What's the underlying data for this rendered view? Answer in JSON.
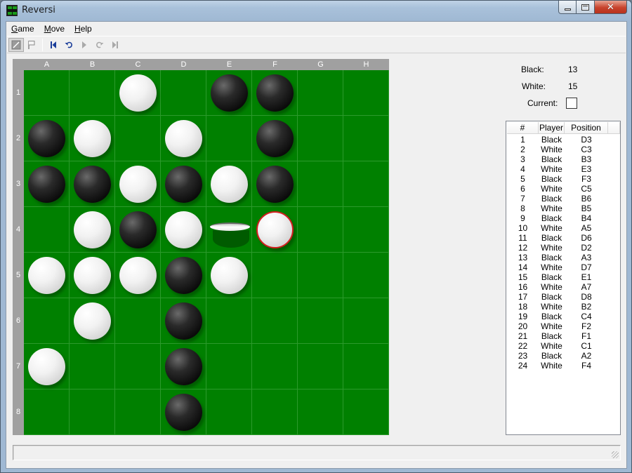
{
  "window": {
    "title": "Reversi",
    "colors": {
      "board": "#008000",
      "frame": "#a0a0a0",
      "last_move_ring": "#d21e1e"
    }
  },
  "menu": {
    "game": {
      "accel": "G",
      "rest": "ame"
    },
    "move": {
      "accel": "M",
      "rest": "ove"
    },
    "help": {
      "accel": "H",
      "rest": "elp"
    }
  },
  "toolbar": {
    "icons": [
      "new-game-icon",
      "flag-icon",
      "first-move-icon",
      "undo-icon",
      "play-icon",
      "redo-icon",
      "last-move-icon"
    ]
  },
  "board": {
    "columns": [
      "A",
      "B",
      "C",
      "D",
      "E",
      "F",
      "G",
      "H"
    ],
    "rows": [
      "1",
      "2",
      "3",
      "4",
      "5",
      "6",
      "7",
      "8"
    ],
    "cells": [
      [
        "",
        "",
        "W",
        "",
        "B",
        "B",
        "",
        ""
      ],
      [
        "B",
        "W",
        "",
        "W",
        "",
        "B",
        "",
        ""
      ],
      [
        "B",
        "B",
        "W",
        "B",
        "W",
        "B",
        "",
        ""
      ],
      [
        "",
        "W",
        "B",
        "W",
        "flip",
        "W*",
        "",
        ""
      ],
      [
        "W",
        "W",
        "W",
        "B",
        "W",
        "",
        "",
        ""
      ],
      [
        "",
        "W",
        "",
        "B",
        "",
        "",
        "",
        ""
      ],
      [
        "W",
        "",
        "",
        "B",
        "",
        "",
        "",
        ""
      ],
      [
        "",
        "",
        "",
        "B",
        "",
        "",
        "",
        ""
      ]
    ],
    "legend": {
      "B": "black disc",
      "W": "white disc",
      "W*": "last move (white)",
      "flip": "disc being flipped"
    }
  },
  "score": {
    "black_label": "Black:",
    "black_value": "13",
    "white_label": "White:",
    "white_value": "15",
    "current_label": "Current:",
    "current_color": "White"
  },
  "history": {
    "headers": [
      "#",
      "Player",
      "Position"
    ],
    "moves": [
      [
        "1",
        "Black",
        "D3"
      ],
      [
        "2",
        "White",
        "C3"
      ],
      [
        "3",
        "Black",
        "B3"
      ],
      [
        "4",
        "White",
        "E3"
      ],
      [
        "5",
        "Black",
        "F3"
      ],
      [
        "6",
        "White",
        "C5"
      ],
      [
        "7",
        "Black",
        "B6"
      ],
      [
        "8",
        "White",
        "B5"
      ],
      [
        "9",
        "Black",
        "B4"
      ],
      [
        "10",
        "White",
        "A5"
      ],
      [
        "11",
        "Black",
        "D6"
      ],
      [
        "12",
        "White",
        "D2"
      ],
      [
        "13",
        "Black",
        "A3"
      ],
      [
        "14",
        "White",
        "D7"
      ],
      [
        "15",
        "Black",
        "E1"
      ],
      [
        "16",
        "White",
        "A7"
      ],
      [
        "17",
        "Black",
        "D8"
      ],
      [
        "18",
        "White",
        "B2"
      ],
      [
        "19",
        "Black",
        "C4"
      ],
      [
        "20",
        "White",
        "F2"
      ],
      [
        "21",
        "Black",
        "F1"
      ],
      [
        "22",
        "White",
        "C1"
      ],
      [
        "23",
        "Black",
        "A2"
      ],
      [
        "24",
        "White",
        "F4"
      ]
    ]
  },
  "status": {
    "text": ""
  }
}
